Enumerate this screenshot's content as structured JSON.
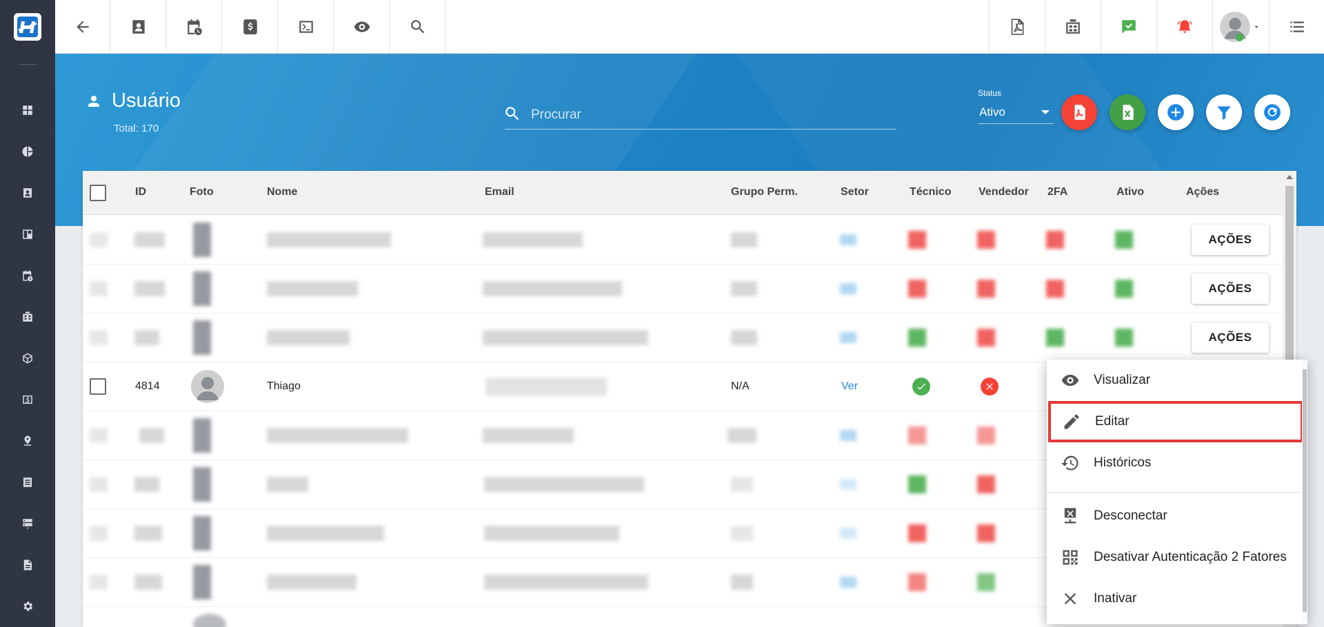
{
  "page": {
    "title": "Usuário",
    "total": "Total: 170",
    "search_placeholder": "Procurar",
    "status_label": "Status",
    "status_value": "Ativo"
  },
  "table": {
    "headers": [
      "ID",
      "Foto",
      "Nome",
      "Email",
      "Grupo Perm.",
      "Setor",
      "Técnico",
      "Vendedor",
      "2FA",
      "Ativo",
      "Ações"
    ],
    "action_label": "AÇÕES",
    "visible_row": {
      "id": "4814",
      "nome": "Thiago",
      "grupo": "N/A",
      "setor": "Ver",
      "tecnico": "yes",
      "vendedor": "no"
    }
  },
  "menu": {
    "items": [
      "Visualizar",
      "Editar",
      "Históricos",
      "Desconectar",
      "Desativar Autenticação 2 Fatores",
      "Inativar"
    ],
    "highlighted": "Editar"
  },
  "colors": {
    "header_blue": "#1e82c4",
    "pdf_red": "#f44336",
    "excel_green": "#43a047",
    "nav_dark": "#2f3542",
    "highlight_red": "#e53935"
  }
}
